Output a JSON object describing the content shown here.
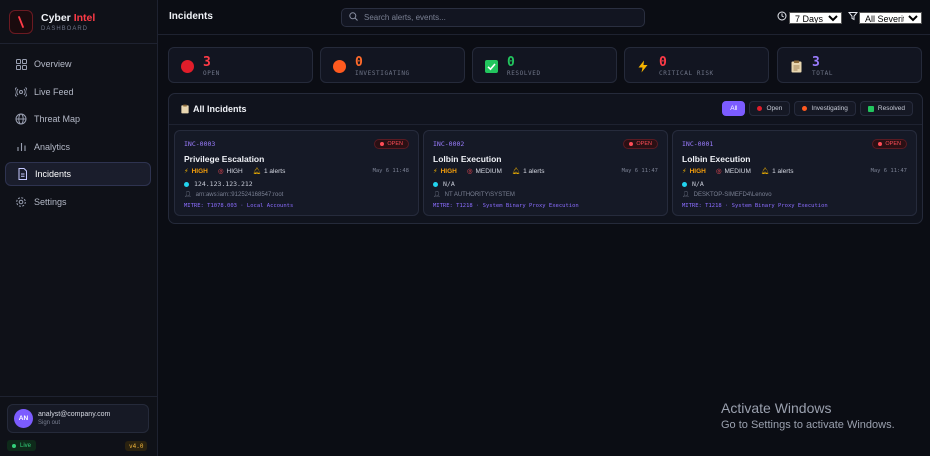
{
  "brand": {
    "name": "Cyber",
    "accent": "Intel",
    "subtitle": "DASHBOARD"
  },
  "nav": [
    {
      "label": "Overview",
      "icon": "grid-icon"
    },
    {
      "label": "Live Feed",
      "icon": "radio-icon"
    },
    {
      "label": "Threat Map",
      "icon": "globe-icon"
    },
    {
      "label": "Analytics",
      "icon": "bar-chart-icon"
    },
    {
      "label": "Incidents",
      "icon": "file-icon",
      "active": true
    },
    {
      "label": "Settings",
      "icon": "gear-icon"
    }
  ],
  "user": {
    "initials": "AN",
    "email": "analyst@company.com",
    "signout": "Sign out"
  },
  "status": {
    "live": "Live",
    "version": "v4.0"
  },
  "header": {
    "title": "Incidents",
    "search_placeholder": "Search alerts, events...",
    "time_range": "7 Days",
    "severity": "All Severity"
  },
  "stats": [
    {
      "value": "3",
      "label": "OPEN",
      "color": "#ff3b47"
    },
    {
      "value": "0",
      "label": "INVESTIGATING",
      "color": "#ff6a2b"
    },
    {
      "value": "0",
      "label": "RESOLVED",
      "color": "#22c55e"
    },
    {
      "value": "0",
      "label": "CRITICAL RISK",
      "color": "#ff3b47"
    },
    {
      "value": "3",
      "label": "TOTAL",
      "color": "#9b7dff"
    }
  ],
  "panel": {
    "title": "All Incidents",
    "filters": {
      "all": "All",
      "open": "Open",
      "investigating": "Investigating",
      "resolved": "Resolved"
    }
  },
  "incidents": [
    {
      "id": "INC-0003",
      "status": "OPEN",
      "title": "Privilege Escalation",
      "severity": "HIGH",
      "priority": "HIGH",
      "alerts": "1 alerts",
      "time": "May 6 11:48",
      "ip": "124.123.123.212",
      "user": "arn:aws:iam::912524168547:root",
      "mitre": "MITRE: T1078.003 · Local Accounts"
    },
    {
      "id": "INC-0002",
      "status": "OPEN",
      "title": "Lolbin Execution",
      "severity": "HIGH",
      "priority": "MEDIUM",
      "alerts": "1 alerts",
      "time": "May 6 11:47",
      "ip": "N/A",
      "user": "NT AUTHORITY\\SYSTEM",
      "mitre": "MITRE: T1218 · System Binary Proxy Execution"
    },
    {
      "id": "INC-0001",
      "status": "OPEN",
      "title": "Lolbin Execution",
      "severity": "HIGH",
      "priority": "MEDIUM",
      "alerts": "1 alerts",
      "time": "May 6 11:47",
      "ip": "N/A",
      "user": "DESKTOP-SIMEFD4\\Lenovo",
      "mitre": "MITRE: T1218 · System Binary Proxy Execution"
    }
  ],
  "watermark": {
    "title": "Activate Windows",
    "subtitle": "Go to Settings to activate Windows."
  }
}
